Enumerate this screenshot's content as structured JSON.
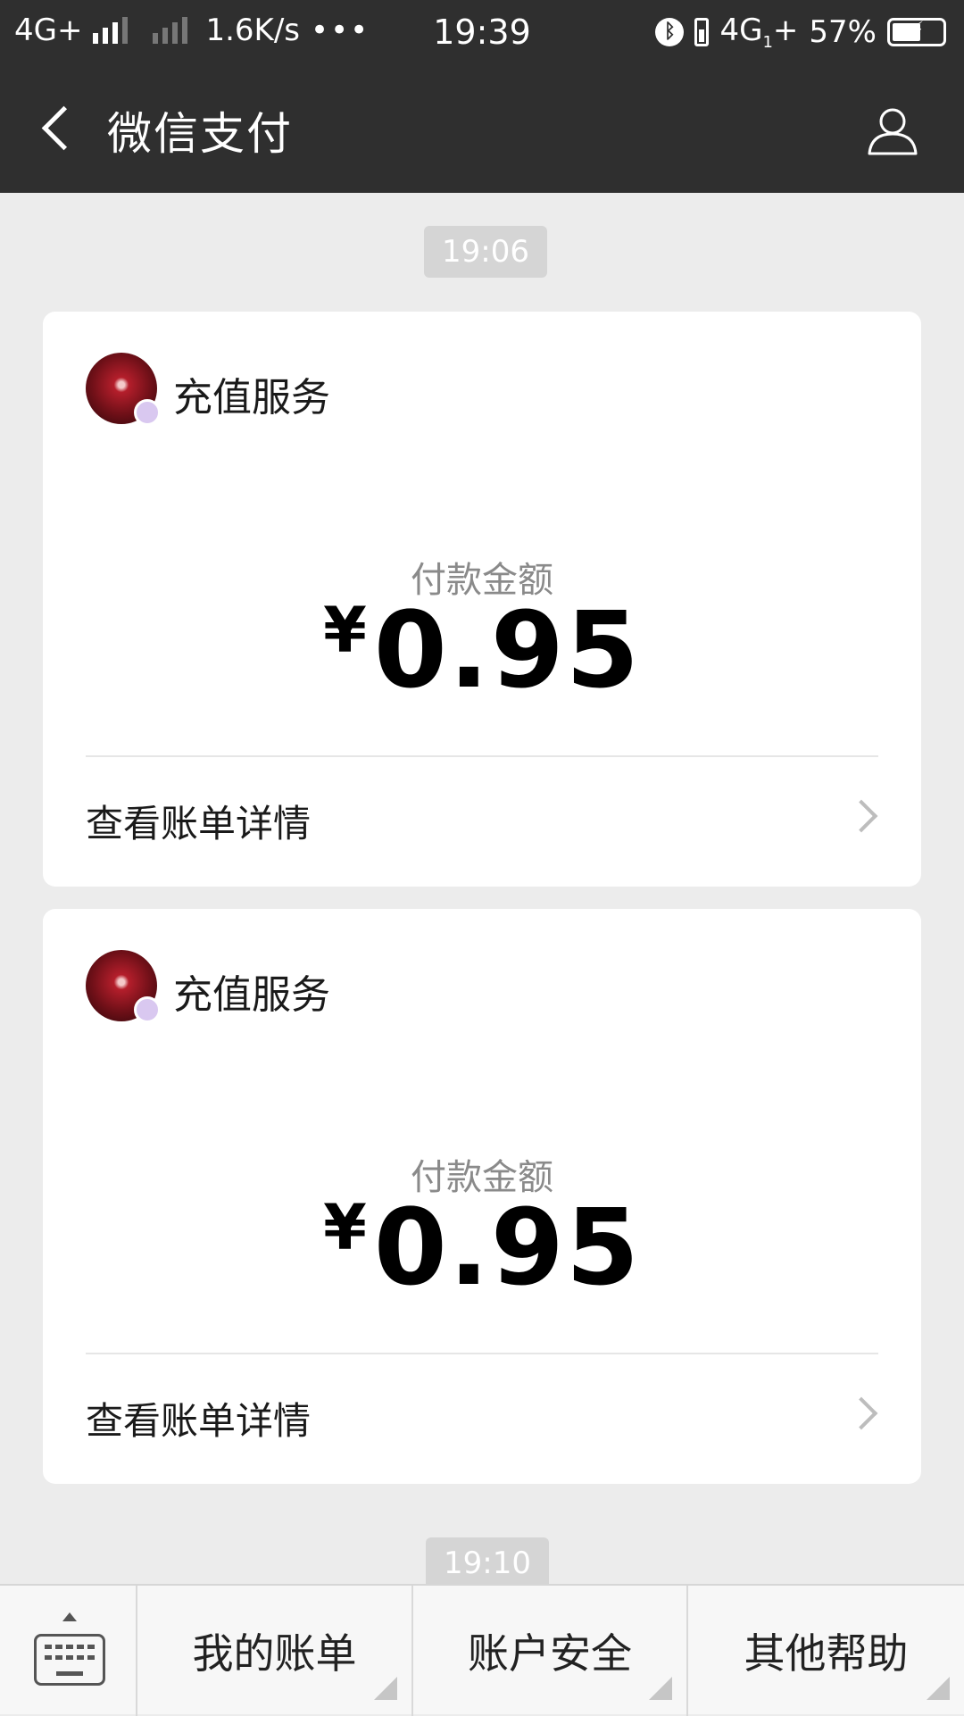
{
  "status_bar": {
    "network_1": "4G+",
    "speed": "1.6K/s",
    "more": "•••",
    "time": "19:39",
    "network_2": "4G",
    "network_2_suffix": "+",
    "battery": "57%",
    "battery_level": 0.57,
    "bluetooth_icon": "bluetooth-icon"
  },
  "nav": {
    "back_icon": "chevron-left-icon",
    "title": "微信支付",
    "profile_icon": "person-icon"
  },
  "timestamps": [
    "19:06",
    "19:10"
  ],
  "cards": [
    {
      "merchant": "充值服务",
      "amount_label": "付款金额",
      "currency": "¥",
      "amount": "0.95",
      "detail_link": "查看账单详情"
    },
    {
      "merchant": "充值服务",
      "amount_label": "付款金额",
      "currency": "¥",
      "amount": "0.95",
      "detail_link": "查看账单详情"
    }
  ],
  "bottom_menu": {
    "keyboard_icon": "keyboard-icon",
    "items": [
      "我的账单",
      "账户安全",
      "其他帮助"
    ]
  },
  "colors": {
    "header_bg": "#2f2f2f",
    "page_bg": "#ececec",
    "card_bg": "#ffffff"
  }
}
